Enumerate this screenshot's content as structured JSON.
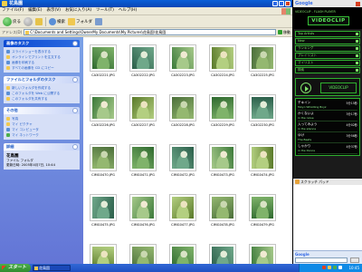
{
  "window": {
    "title": "花鳥園"
  },
  "menu": [
    "ファイル(F)",
    "編集(E)",
    "表示(V)",
    "お気に入り(A)",
    "ツール(T)",
    "ヘルプ(H)"
  ],
  "toolbar": {
    "back": "戻る",
    "search": "検索",
    "folders": "フォルダ"
  },
  "address": {
    "label": "アドレス(D)",
    "value": "C:\\Documents and Settings\\OwnerMy Documents\\My Pictures\\花鳥園\\花鳥園",
    "go": "移動"
  },
  "taskpane": {
    "picture_tasks": {
      "title": "画像のタスク",
      "items": [
        "スライドショーを表示する",
        "オンラインでプリントを注文する",
        "画像を印刷する",
        "すべての画像を CD にコピー"
      ]
    },
    "file_tasks": {
      "title": "ファイルとフォルダのタスク",
      "items": [
        "新しいフォルダを作成する",
        "このフォルダを Web に公開する",
        "このフォルダを共有する"
      ]
    },
    "other_places": {
      "title": "その他",
      "items": [
        "写真",
        "マイ ピクチャ",
        "マイ コンピュータ",
        "マイ ネットワーク"
      ]
    },
    "details": {
      "title": "詳細",
      "name": "花鳥園",
      "type": "ファイル フォルダ",
      "date": "更新日時: 2005年4月7日, 10:44"
    }
  },
  "thumbnails": [
    "CA302221.JPG",
    "CA302222.JPG",
    "CA302223.JPG",
    "CA302224.JPG",
    "CA302225.JPG",
    "CA302226.JPG",
    "CA302227.JPG",
    "CA302228.JPG",
    "CA302229.JPG",
    "CA302230.JPG",
    "CIMG0470.JPG",
    "CIMG0471.JPG",
    "CIMG0472.JPG",
    "CIMG0473.JPG",
    "CIMG0474.JPG",
    "CIMG0475.JPG",
    "CIMG0476.JPG",
    "CIMG0477.JPG",
    "CIMG0478.JPG",
    "CIMG0479.JPG",
    "",
    "",
    "",
    "",
    ""
  ],
  "sidepanel": {
    "google_label": "Google",
    "tagline": "VIDEOCLIP - FLASH PLAYER",
    "logo": "VIDEOCLIP",
    "rows": [
      "Top Artists",
      "New",
      "ランキング",
      "プレイリスト",
      "マイリスト",
      "検索"
    ],
    "player_logo": "VIDEOCLIP",
    "playlist": [
      {
        "title": "チキイン",
        "sub": "Tokyo Whistling Boyz",
        "dur": "5分15秒"
      },
      {
        "title": "かくないよ",
        "sub": "in the noise",
        "dur": "3分17秒"
      },
      {
        "title": "入ってみよう",
        "sub": "in the silence",
        "dur": "4分02秒"
      },
      {
        "title": "ゆけ",
        "sub": "The Beats",
        "dur": "3分56秒"
      },
      {
        "title": "しゃかり",
        "sub": "in the Dance",
        "dur": "4分37秒"
      }
    ],
    "widget": "スクラッチ パッド"
  },
  "taskbar": {
    "start": "スタート",
    "item": "花鳥園",
    "clock": "10:45"
  },
  "colors": {
    "title_blue": "#0a5fd8",
    "task_pane": "#6b8be0",
    "neon_green": "#5df05d"
  }
}
